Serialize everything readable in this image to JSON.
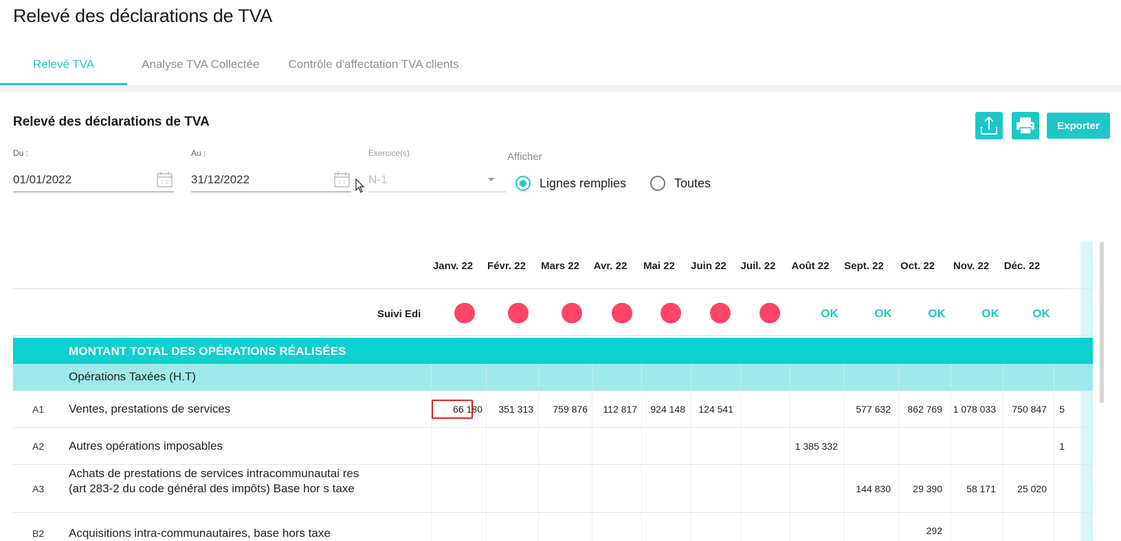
{
  "page": {
    "title": "Relevé des déclarations de TVA"
  },
  "tabs": [
    {
      "label": "Relevé TVA",
      "active": true
    },
    {
      "label": "Analyse TVA Collectée",
      "active": false
    },
    {
      "label": "Contrôle d'affectation TVA clients",
      "active": false
    }
  ],
  "section": {
    "title": "Relevé des déclarations de TVA"
  },
  "toolbar": {
    "upload_icon": "upload-icon",
    "print_icon": "printer-icon",
    "export_label": "Exporter"
  },
  "filters": {
    "du": {
      "label": "Du :",
      "value": "01/01/2022"
    },
    "au": {
      "label": "Au :",
      "value": "31/12/2022"
    },
    "exercice": {
      "label": "Exercice(s)",
      "value": "N-1"
    },
    "afficher": {
      "label": "Afficher",
      "options": [
        {
          "label": "Lignes remplies",
          "checked": true
        },
        {
          "label": "Toutes",
          "checked": false
        }
      ]
    }
  },
  "table": {
    "months": [
      "Janv. 22",
      "Févr. 22",
      "Mars 22",
      "Avr. 22",
      "Mai 22",
      "Juin 22",
      "Juil. 22",
      "Août 22",
      "Sept. 22",
      "Oct. 22",
      "Nov. 22",
      "Déc. 22"
    ],
    "suivi_label": "Suivi Edi",
    "suivi_status": [
      "missing",
      "missing",
      "missing",
      "missing",
      "missing",
      "missing",
      "missing",
      "OK",
      "OK",
      "OK",
      "OK",
      "OK"
    ],
    "status_ok_text": "OK",
    "section_header": "MONTANT TOTAL DES OPÉRATIONS RÉALISÉES",
    "subsection_header": "Opérations Taxées (H.T)",
    "rows": [
      {
        "code": "A1",
        "label": "Ventes, prestations de services",
        "values": [
          "66 180",
          "351 313",
          "759 876",
          "112 817",
          "924 148",
          "124 541",
          "",
          "",
          "577 632",
          "862 769",
          "1 078 033",
          "750 847"
        ],
        "overflow": "5",
        "highlighted_index": 0
      },
      {
        "code": "A2",
        "label": "Autres opérations imposables",
        "values": [
          "",
          "",
          "",
          "",
          "",
          "",
          "",
          "1 385 332",
          "",
          "",
          "",
          ""
        ],
        "overflow": "1"
      },
      {
        "code": "A3",
        "label": "Achats de prestations de services intracommunautai res (art 283-2 du code général des impôts) Base hor s taxe",
        "values": [
          "",
          "",
          "",
          "",
          "",
          "",
          "",
          "",
          "144 830",
          "29 390",
          "58 171",
          "25 020"
        ],
        "overflow": ""
      },
      {
        "code": "B2",
        "label": "Acquisitions intra-communautaires, base hors taxe",
        "values": [
          "",
          "",
          "",
          "",
          "",
          "",
          "",
          "",
          "",
          "292",
          "",
          ""
        ],
        "overflow": ""
      }
    ]
  },
  "colors": {
    "accent": "#1ec8c8",
    "band": "#0fd0d0",
    "band_light": "#9ee9e9",
    "alert": "#ff4466",
    "highlight": "#e02020"
  }
}
